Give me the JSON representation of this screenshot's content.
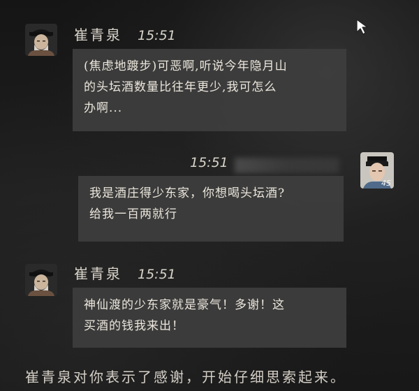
{
  "messages": [
    {
      "sender": "崔青泉",
      "time": "15:51",
      "avatar_icon": "elder-official-portrait-icon",
      "text": "(焦虑地踱步)可恶啊,听说今年隐月山\n的头坛酒数量比往年更少,我可怎么\n办啊..."
    },
    {
      "sender": "",
      "time": "15:51",
      "avatar_icon": "young-scholar-portrait-icon",
      "avatar_level": "45",
      "text": "我是酒庄得少东家，你想喝头坛酒?\n给我一百两就行"
    },
    {
      "sender": "崔青泉",
      "time": "15:51",
      "avatar_icon": "elder-official-portrait-icon",
      "text": "神仙渡的少东家就是豪气！多谢！这\n买酒的钱我来出！"
    }
  ],
  "system_message": "崔青泉对你表示了感谢，开始仔细思索起来。",
  "cursor_icon": "mouse-pointer-icon",
  "colors": {
    "background": "#1b1b1b",
    "bubble": "#3e3e3e",
    "text": "#ece7dd"
  }
}
